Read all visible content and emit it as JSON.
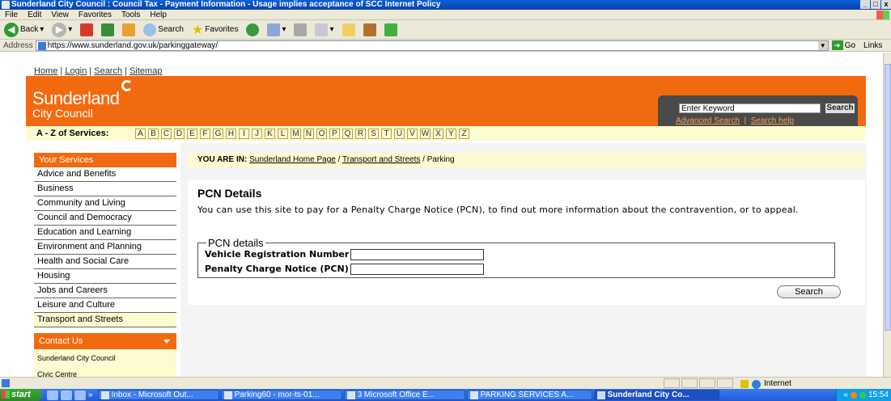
{
  "window": {
    "title": "Sunderland City Council : Council Tax - Payment Information - Usage implies acceptance of SCC Internet Policy",
    "controls": [
      "_",
      "□",
      "x"
    ]
  },
  "menu": [
    "File",
    "Edit",
    "View",
    "Favorites",
    "Tools",
    "Help"
  ],
  "toolbar": {
    "back": "Back",
    "search": "Search",
    "favorites": "Favorites"
  },
  "address": {
    "label": "Address",
    "url": "https://www.sunderland.gov.uk/parkinggateway/",
    "go": "Go",
    "links": "Links"
  },
  "page": {
    "toplinks": [
      "Home",
      "Login",
      "Search",
      "Sitemap"
    ],
    "logo": {
      "line1": "Sunderland",
      "line2": "City Council"
    },
    "search": {
      "placeholder": "Enter Keyword",
      "button": "Search",
      "advanced": "Advanced Search",
      "help": "Search help"
    },
    "az": {
      "label": "A - Z of Services:",
      "letters": [
        "A",
        "B",
        "C",
        "D",
        "E",
        "F",
        "G",
        "H",
        "I",
        "J",
        "K",
        "L",
        "M",
        "N",
        "O",
        "P",
        "Q",
        "R",
        "S",
        "T",
        "U",
        "V",
        "W",
        "X",
        "Y",
        "Z"
      ]
    },
    "sidebar": {
      "heading": "Your Services",
      "items": [
        "Advice and Benefits",
        "Business",
        "Community and Living",
        "Council and Democracy",
        "Education and Learning",
        "Environment and Planning",
        "Health and Social Care",
        "Housing",
        "Jobs and Careers",
        "Leisure and Culture",
        "Transport and Streets"
      ],
      "active_index": 10
    },
    "contact": {
      "heading": "Contact Us",
      "line1": "Sunderland City Council",
      "line2": "Civic Centre"
    },
    "breadcrumb": {
      "label": "YOU ARE IN:",
      "home": "Sunderland Home Page",
      "section": "Transport and Streets",
      "current": "Parking"
    },
    "content": {
      "title": "PCN Details",
      "intro": "You can use this site to pay for a Penalty Charge Notice (PCN), to find out more information about the contravention, or to appeal.",
      "legend": "PCN details",
      "vrn_label": "Vehicle Registration Number",
      "vrn_value": "",
      "pcn_label": "Penalty Charge Notice (PCN)",
      "pcn_value": "",
      "search_button": "Search"
    }
  },
  "statusbar": {
    "zone": "Internet"
  },
  "taskbar": {
    "start": "start",
    "chevron": "»",
    "tasks": [
      "Inbox - Microsoft Out...",
      "Parking60 - mor-ts-01...",
      "3 Microsoft Office E...",
      "PARKING SERVICES A...",
      "Sunderland City Co..."
    ],
    "tray_chevron": "«",
    "clock": "15:54"
  }
}
